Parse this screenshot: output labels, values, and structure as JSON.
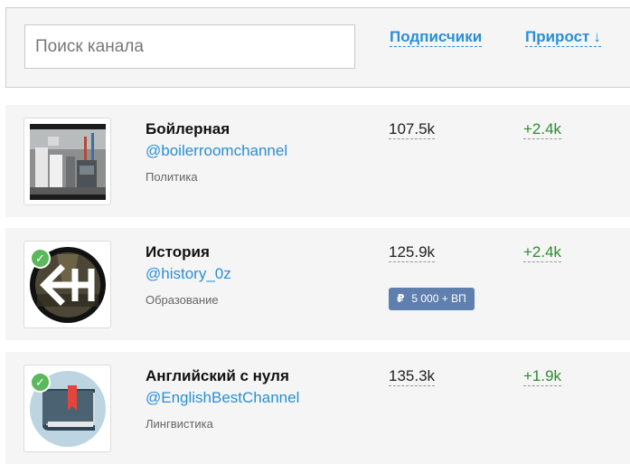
{
  "search": {
    "placeholder": "Поиск канала"
  },
  "sort": {
    "subscribers_label": "Подписчики",
    "growth_label": "Прирост",
    "growth_arrow": "↓"
  },
  "channels": [
    {
      "name": "Бойлерная",
      "handle": "@boilerroomchannel",
      "category": "Политика",
      "subscribers": "107.5k",
      "growth": "+2.4k",
      "verified": false
    },
    {
      "name": "История",
      "handle": "@history_0z",
      "category": "Образование",
      "subscribers": "125.9k",
      "growth": "+2.4k",
      "verified": true,
      "ad": {
        "currency_icon": "₽",
        "label": "5 000 + ВП"
      }
    },
    {
      "name": "Английский с нуля",
      "handle": "@EnglishBestChannel",
      "category": "Лингвистика",
      "subscribers": "135.3k",
      "growth": "+1.9k",
      "verified": true
    }
  ],
  "icons": {
    "verified": "check-badge-icon",
    "currency": "ruble-icon"
  },
  "colors": {
    "link": "#2a8fd6",
    "growth": "#2f8a2f",
    "verified": "#5cb85c",
    "badge": "#5f7fae",
    "card_bg": "#f5f5f5"
  }
}
